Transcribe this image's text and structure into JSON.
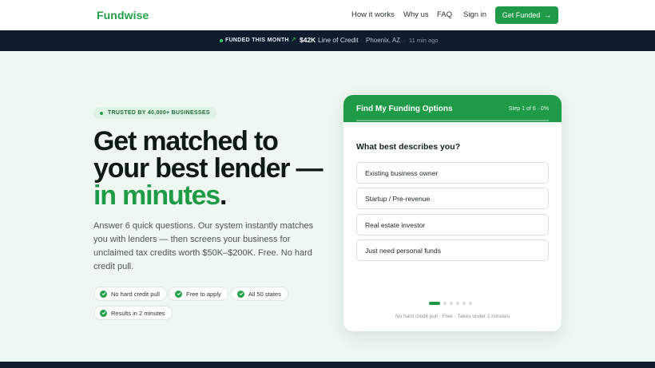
{
  "nav": {
    "logo": "Fundwise",
    "links": [
      "How it works",
      "Why us",
      "FAQ",
      "Sign in"
    ],
    "cta_label": "Get Funded",
    "cta_arrow": "→"
  },
  "ticker": {
    "label": "FUNDED THIS MONTH",
    "trend_icon": "↗",
    "amount": "$42K",
    "product": "Line of Credit",
    "separator": "·",
    "location": "Phoenix, AZ",
    "time": "11 min ago"
  },
  "hero": {
    "badge": "TRUSTED BY 40,000+ BUSINESSES",
    "headline_line1": "Get matched to",
    "headline_line2": "your best lender —",
    "headline_accent": "in minutes",
    "headline_period": ".",
    "subtext": "Answer 6 quick questions. Our system instantly matches you with lenders — then screens your business for unclaimed tax credits worth $50K–$200K. Free. No hard credit pull.",
    "chips": [
      "No hard credit pull",
      "Free to apply",
      "All 50 states",
      "Results in 2 minutes"
    ]
  },
  "card": {
    "title": "Find My Funding Options",
    "step": "Step 1 of 6 · 0%",
    "progress": 0,
    "question": "What best describes you?",
    "options": [
      "Existing business owner",
      "Startup / Pre-revenue",
      "Real estate investor",
      "Just need personal funds"
    ],
    "total_steps": 6,
    "current_step": 1,
    "footnote": "No hard credit pull · Free · Takes under 2 minutes"
  },
  "colors": {
    "brand_green": "#1f9a47",
    "dark_navy": "#0f1c2e",
    "hero_bg": "#eef8f1"
  }
}
